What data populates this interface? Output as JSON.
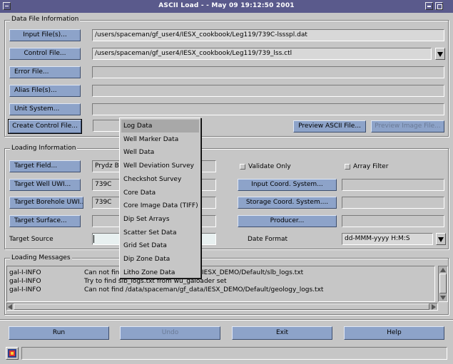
{
  "window": {
    "title": "ASCII Load - - May 09 19:12:50 2001"
  },
  "data_file_info": {
    "title": "Data File Information",
    "input_files_label": "Input File(s)...",
    "input_files_value": "/users/spaceman/gf_user4/IESX_cookbook/Leg119/739C-lssspl.dat",
    "control_file_label": "Control File...",
    "control_file_value": "/users/spaceman/gf_user4/IESX_cookbook/Leg119/739_lss.ctl",
    "error_file_label": "Error File...",
    "error_file_value": "",
    "alias_files_label": "Alias File(s)...",
    "alias_files_value": "",
    "unit_system_label": "Unit System...",
    "unit_system_value": "",
    "create_control_label": "Create Control File...",
    "preview_ascii_label": "Preview ASCII File...",
    "preview_image_label": "Preview Image File..."
  },
  "loading_info": {
    "title": "Loading Information",
    "target_field_label": "Target Field...",
    "target_field_value": "Prydz Ba",
    "target_well_label": "Target Well UWI...",
    "target_well_value": "739C",
    "target_borehole_label": "Target Borehole UWI...",
    "target_borehole_value": "739C",
    "target_surface_label": "Target Surface...",
    "target_surface_value": "",
    "target_source_label": "Target Source",
    "target_source_value": "",
    "validate_only_label": "Validate Only",
    "array_filter_label": "Array Filter",
    "input_coord_label": "Input Coord. System...",
    "input_coord_value": "",
    "storage_coord_label": "Storage Coord. System....",
    "storage_coord_value": "",
    "producer_label": "Producer...",
    "producer_value": "",
    "date_format_label": "Date Format",
    "date_format_value": "dd-MMM-yyyy H:M:S"
  },
  "menu": {
    "items": [
      "Log Data",
      "Well Marker Data",
      "Well Data",
      "Well Deviation Survey",
      "Checkshot Survey",
      "Core Data",
      "Core Image Data (TIFF)",
      "Dip Set Arrays",
      "Scatter Set Data",
      "Grid Set Data",
      "Dip Zone Data",
      "Litho Zone Data"
    ],
    "selected_index": 0
  },
  "loading_messages": {
    "title": "Loading Messages",
    "lines": [
      {
        "code": "gal-I-INFO",
        "msg": "Can not find /data/spaceman/gf_data/IESX_DEMO/Default/slb_logs.txt",
        "visible_msg": "IESX_DEMO/Default/slb_logs.txt"
      },
      {
        "code": "gal-I-INFO",
        "msg": "Try to find slb_logs.txt from wu_galoader set"
      },
      {
        "code": "gal-I-INFO",
        "msg": "Can not find /data/spaceman/gf_data/IESX_DEMO/Default/geology_logs.txt"
      }
    ],
    "line0_prefix": "Can not find"
  },
  "actions": {
    "run": "Run",
    "undo": "Undo",
    "exit": "Exit",
    "help": "Help"
  },
  "status": {
    "text": ""
  },
  "colors": {
    "titlebar": "#5a5a8c",
    "button": "#8da3c9",
    "background": "#c6c6c6"
  }
}
